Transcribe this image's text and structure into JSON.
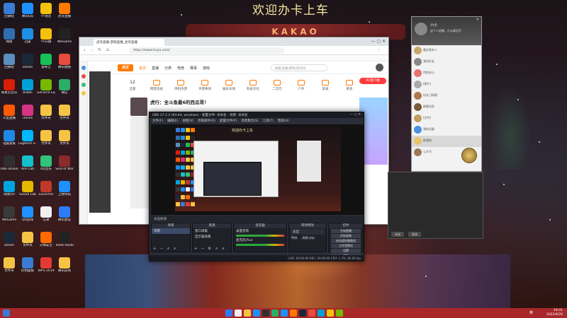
{
  "wallpaper": {
    "title": "欢迎办卡上车",
    "sign_text": "KAKAO"
  },
  "desktop_icons": [
    {
      "label": "回收站",
      "color": "#3a7bd5"
    },
    {
      "label": "腾讯QQ",
      "color": "#1e90ff"
    },
    {
      "label": "YY语音",
      "color": "#f4c20d"
    },
    {
      "label": "虎牙直播",
      "color": "#ff7a00"
    },
    {
      "label": "网络",
      "color": "#2f6fb0"
    },
    {
      "label": "迅雷",
      "color": "#1f8ee8"
    },
    {
      "label": "YY开播",
      "color": "#f4c20d"
    },
    {
      "label": "WeGame",
      "color": "#222"
    },
    {
      "label": "回收站",
      "color": "#5a8fc0"
    },
    {
      "label": "Steam",
      "color": "#1b2838"
    },
    {
      "label": "爱奇艺",
      "color": "#19c05a"
    },
    {
      "label": "腾讯视频",
      "color": "#e94b3c"
    },
    {
      "label": "网易云音乐",
      "color": "#d81e06"
    },
    {
      "label": "bilibili",
      "color": "#00a1d6"
    },
    {
      "label": "GeForce Experience",
      "color": "#76b900"
    },
    {
      "label": "微信",
      "color": "#2aae67"
    },
    {
      "label": "斗鱼直播",
      "color": "#ff5a00"
    },
    {
      "label": "iTunes",
      "color": "#d63384"
    },
    {
      "label": "文件夹",
      "color": "#f6c445"
    },
    {
      "label": "文件夹",
      "color": "#f6c445"
    },
    {
      "label": "电脑管家",
      "color": "#1e88e5"
    },
    {
      "label": "Logitech G HUB",
      "color": "#00b8fc"
    },
    {
      "label": "文件夹",
      "color": "#f6c445"
    },
    {
      "label": "文件夹",
      "color": "#f6c445"
    },
    {
      "label": "OBS Studio",
      "color": "#302e31"
    },
    {
      "label": "Aim Lab",
      "color": "#14c0c9"
    },
    {
      "label": "QQ音乐",
      "color": "#31c27c"
    },
    {
      "label": "Seal of War",
      "color": "#8a2a2a"
    },
    {
      "label": "网易UU",
      "color": "#00a5e0"
    },
    {
      "label": "Sound Lab",
      "color": "#e6b800"
    },
    {
      "label": "Launcher",
      "color": "#c0392b"
    },
    {
      "label": "上网导航",
      "color": "#1e90ff"
    },
    {
      "label": "WeGame",
      "color": "#3a3a3a"
    },
    {
      "label": "QQ游戏",
      "color": "#1e90ff"
    },
    {
      "label": "记录",
      "color": "#f0f0f0"
    },
    {
      "label": "腾讯会议",
      "color": "#2d7cf6"
    },
    {
      "label": "steam",
      "color": "#1b2838"
    },
    {
      "label": "文件夹",
      "color": "#f6c445"
    },
    {
      "label": "火绒安全",
      "color": "#ff6a00"
    },
    {
      "label": "Tomb Raider",
      "color": "#222"
    },
    {
      "label": "文件夹",
      "color": "#f6c445"
    },
    {
      "label": "控制面板",
      "color": "#3a7bd5"
    },
    {
      "label": "WPS 2019",
      "color": "#e53935"
    },
    {
      "label": "腾讯游戏",
      "color": "#f6c445"
    }
  ],
  "browser": {
    "tab_title": "虎牙直播-游戏直播_虎牙直播",
    "url": "https://www.huya.com/",
    "site_logo": "虎牙",
    "nav": [
      "首页",
      "直播",
      "分类",
      "电竞",
      "赛事",
      "游戏"
    ],
    "search_placeholder": "搜索主播/游戏/房间号",
    "categories": [
      {
        "label": "全部",
        "badge": "12"
      },
      {
        "label": "网游竞技"
      },
      {
        "label": "单机热游"
      },
      {
        "label": "手游休闲"
      },
      {
        "label": "娱乐天地"
      },
      {
        "label": "科技文化"
      },
      {
        "label": "二次元"
      },
      {
        "label": "户外"
      },
      {
        "label": "美食"
      },
      {
        "label": "更多"
      }
    ],
    "pc_button": "PC客户端",
    "streamer_title": "虎行：全斗鱼最6的西瓜哥！"
  },
  "obs": {
    "window_title": "OBS 27.2.4 (64-bit, windows) - 配置文件: 未命名 - 场景: 未命名",
    "menu": [
      "文件(F)",
      "编辑(E)",
      "视图(V)",
      "停靠部件(D)",
      "配置文件(P)",
      "场景集合(S)",
      "工具(T)",
      "帮助(H)"
    ],
    "nested_title": "欢迎办卡上车",
    "dock_bar": "未选择源",
    "docks": {
      "scenes": {
        "title": "场景",
        "items": [
          "场景"
        ]
      },
      "sources": {
        "title": "来源",
        "items": [
          "窗口采集",
          "显示器采集"
        ]
      },
      "mixer": {
        "title": "混音器",
        "items": [
          "桌面音频",
          "麦克风/Aux"
        ]
      },
      "transitions": {
        "title": "转场特效",
        "type": "淡出",
        "duration_label": "时长",
        "duration": "300 ms"
      },
      "controls": {
        "title": "控件",
        "buttons": [
          "开始直播",
          "开始录制",
          "启动虚拟摄像机",
          "工作室模式",
          "设置",
          "退出"
        ]
      }
    },
    "status": "LIVE: 00:00:00  REC: 00:00:00  CPU: 1.3%, 60.00 fps"
  },
  "chat": {
    "name": "小小",
    "signature": "这个人很懒，什么都没写",
    "items": [
      {
        "text": "最近联系人",
        "color": "#c9a66b"
      },
      {
        "text": "我的好友",
        "color": "#888"
      },
      {
        "text": "特别关心",
        "color": "#e57373"
      },
      {
        "text": "[图片]",
        "color": "#aaa"
      },
      {
        "text": "好友 [表情]",
        "color": "#b07a4a"
      },
      {
        "text": "群聊消息",
        "color": "#7a5a3a"
      },
      {
        "text": "[文件]",
        "color": "#c0a060"
      },
      {
        "text": "我的设备",
        "color": "#4a90e2"
      },
      {
        "text": "群通知",
        "color": "#e8c46a"
      },
      {
        "text": "公众号",
        "color": "#9a7a5a"
      }
    ]
  },
  "chat_dialog": {
    "buttons": [
      "关闭",
      "发送"
    ]
  },
  "taskbar": {
    "time": "19:41",
    "date": "2022/6/20",
    "tray": "英"
  }
}
